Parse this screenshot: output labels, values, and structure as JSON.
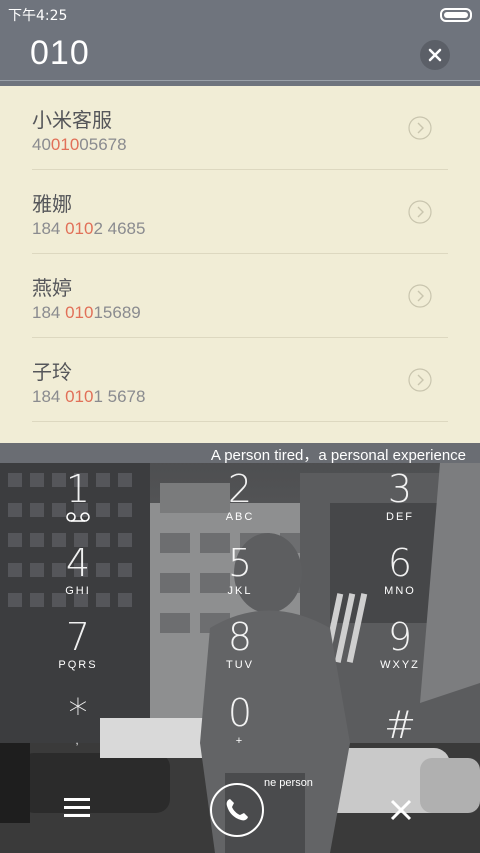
{
  "status": {
    "time": "下午4:25"
  },
  "search": {
    "number": "010"
  },
  "results": [
    {
      "name": "小米客服",
      "num_pre": "40",
      "num_hl": "010",
      "num_post": "05678"
    },
    {
      "name": "雅娜",
      "num_pre": "184 ",
      "num_hl": "010",
      "num_post": "2 4685"
    },
    {
      "name": "燕婷",
      "num_pre": "184 ",
      "num_hl": "010",
      "num_post": "15689"
    },
    {
      "name": "子玲",
      "num_pre": "184 ",
      "num_hl": "010",
      "num_post": "1 5678"
    }
  ],
  "banner": "A  person tired，a personal experience",
  "keys": [
    {
      "digit": "1",
      "letters": "oo"
    },
    {
      "digit": "2",
      "letters": "ABC"
    },
    {
      "digit": "3",
      "letters": "DEF"
    },
    {
      "digit": "4",
      "letters": "GHI"
    },
    {
      "digit": "5",
      "letters": "JKL"
    },
    {
      "digit": "6",
      "letters": "MNO"
    },
    {
      "digit": "7",
      "letters": "PQRS"
    },
    {
      "digit": "8",
      "letters": "TUV"
    },
    {
      "digit": "9",
      "letters": "WXYZ"
    },
    {
      "digit": "*",
      "letters": ","
    },
    {
      "digit": "0",
      "letters": "+"
    },
    {
      "digit": "#",
      "letters": ""
    }
  ],
  "footer": {
    "caption": "ne person"
  },
  "colors": {
    "highlight": "#e17058",
    "list_bg": "#f1edd6",
    "header_bg": "#6f747d"
  }
}
